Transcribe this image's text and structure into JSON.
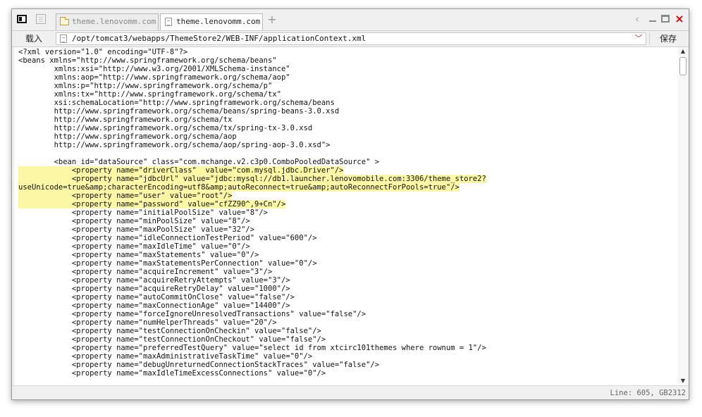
{
  "tabs": [
    {
      "label": "theme.lenovomm.com",
      "icon": "folder-icon",
      "active": false
    },
    {
      "label": "theme.lenovomm.com",
      "icon": "document-icon",
      "active": true
    }
  ],
  "new_tab_label": "+",
  "window_controls": {
    "back": "‹",
    "close": "×"
  },
  "toolbar": {
    "load_label": "载入",
    "path": "/opt/tomcat3/webapps/ThemeStore2/WEB-INF/applicationContext.xml",
    "dropdown_icon": "﹀",
    "save_label": "保存"
  },
  "editor": {
    "highlight_color": "#fbf7a4",
    "lines": [
      {
        "text": "<?xml version=\"1.0\" encoding=\"UTF-8\"?>",
        "highlight": false
      },
      {
        "text": "<beans xmlns=\"http://www.springframework.org/schema/beans\"",
        "highlight": false
      },
      {
        "text": "        xmlns:xsi=\"http://www.w3.org/2001/XMLSchema-instance\"",
        "highlight": false
      },
      {
        "text": "        xmlns:aop=\"http://www.springframework.org/schema/aop\"",
        "highlight": false
      },
      {
        "text": "        xmlns:p=\"http://www.springframework.org/schema/p\"",
        "highlight": false
      },
      {
        "text": "        xmlns:tx=\"http://www.springframework.org/schema/tx\"",
        "highlight": false
      },
      {
        "text": "        xsi:schemaLocation=\"http://www.springframework.org/schema/beans",
        "highlight": false
      },
      {
        "text": "        http://www.springframework.org/schema/beans/spring-beans-3.0.xsd",
        "highlight": false
      },
      {
        "text": "        http://www.springframework.org/schema/tx",
        "highlight": false
      },
      {
        "text": "        http://www.springframework.org/schema/tx/spring-tx-3.0.xsd",
        "highlight": false
      },
      {
        "text": "        http://www.springframework.org/schema/aop",
        "highlight": false
      },
      {
        "text": "        http://www.springframework.org/schema/aop/spring-aop-3.0.xsd\">",
        "highlight": false
      },
      {
        "text": "",
        "highlight": false
      },
      {
        "text": "        <bean id=\"dataSource\" class=\"com.mchange.v2.c3p0.ComboPooledDataSource\" >",
        "highlight": false
      },
      {
        "text": "            <property name=\"driverClass\"  value=\"com.mysql.jdbc.Driver\"/>",
        "highlight": true
      },
      {
        "text": "            <property name=\"jdbcUrl\" value=\"jdbc:mysql://db1.launcher.lenovomobile.com:3306/theme_store2?",
        "highlight": true
      },
      {
        "text": "useUnicode=true&amp;characterEncoding=utf8&amp;autoReconnect=true&amp;autoReconnectForPools=true\"/>",
        "highlight": true
      },
      {
        "text": "            <property name=\"user\" value=\"root\"/>",
        "highlight": true
      },
      {
        "text": "            <property name=\"password\" value=\"cfZZ90^,9+Cn\"/>",
        "highlight": true
      },
      {
        "text": "            <property name=\"initialPoolSize\" value=\"8\"/>",
        "highlight": false
      },
      {
        "text": "            <property name=\"minPoolSize\" value=\"8\"/>",
        "highlight": false
      },
      {
        "text": "            <property name=\"maxPoolSize\" value=\"32\"/>",
        "highlight": false
      },
      {
        "text": "            <property name=\"idleConnectionTestPeriod\" value=\"600\"/>",
        "highlight": false
      },
      {
        "text": "            <property name=\"maxIdleTime\" value=\"0\"/>",
        "highlight": false
      },
      {
        "text": "            <property name=\"maxStatements\" value=\"0\"/>",
        "highlight": false
      },
      {
        "text": "            <property name=\"maxStatementsPerConnection\" value=\"0\"/>",
        "highlight": false
      },
      {
        "text": "            <property name=\"acquireIncrement\" value=\"3\"/>",
        "highlight": false
      },
      {
        "text": "            <property name=\"acquireRetryAttempts\" value=\"3\"/>",
        "highlight": false
      },
      {
        "text": "            <property name=\"acquireRetryDelay\" value=\"1000\"/>",
        "highlight": false
      },
      {
        "text": "            <property name=\"autoCommitOnClose\" value=\"false\"/>",
        "highlight": false
      },
      {
        "text": "            <property name=\"maxConnectionAge\" value=\"14400\"/>",
        "highlight": false
      },
      {
        "text": "            <property name=\"forceIgnoreUnresolvedTransactions\" value=\"false\"/>",
        "highlight": false
      },
      {
        "text": "            <property name=\"numHelperThreads\" value=\"20\"/>",
        "highlight": false
      },
      {
        "text": "            <property name=\"testConnectionOnCheckin\" value=\"false\"/>",
        "highlight": false
      },
      {
        "text": "            <property name=\"testConnectionOnCheckout\" value=\"false\"/>",
        "highlight": false
      },
      {
        "text": "            <property name=\"preferredTestQuery\" value=\"select id from xtcirc101themes where rownum = 1\"/>",
        "highlight": false
      },
      {
        "text": "            <property name=\"maxAdministrativeTaskTime\" value=\"0\"/>",
        "highlight": false
      },
      {
        "text": "            <property name=\"debugUnreturnedConnectionStackTraces\" value=\"false\"/>",
        "highlight": false
      },
      {
        "text": "            <property name=\"maxIdleTimeExcessConnections\" value=\"0\"/>",
        "highlight": false
      }
    ]
  },
  "scrollbar": {
    "up": "▲",
    "down": "▼"
  },
  "status": {
    "text": "Line: 605, GB2312"
  }
}
